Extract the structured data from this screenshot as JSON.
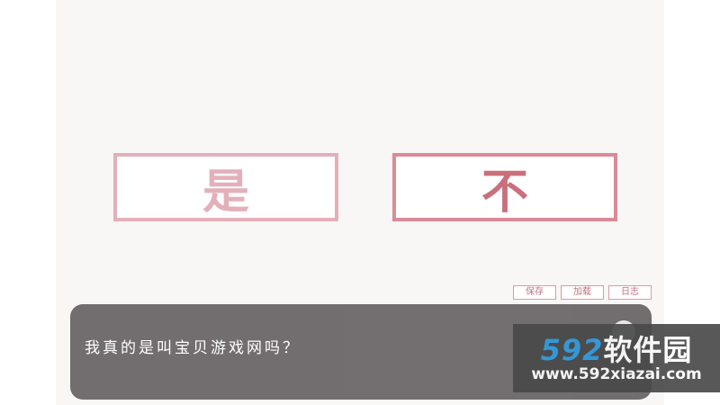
{
  "choices": {
    "yes_label": "是",
    "no_label": "不"
  },
  "quick_menu": {
    "save": "保存",
    "load": "加载",
    "log": "日志"
  },
  "dialogue": {
    "text": "我真的是叫宝贝游戏网吗？"
  },
  "watermark": {
    "logo_number": "592",
    "logo_text": "软件园",
    "url": "www.592xiazai.com"
  },
  "colors": {
    "yes_border": "#e3b0ba",
    "no_border": "#db8a97",
    "dialogue_bg": "#6b6768",
    "page_bg": "#f9f7f6"
  }
}
